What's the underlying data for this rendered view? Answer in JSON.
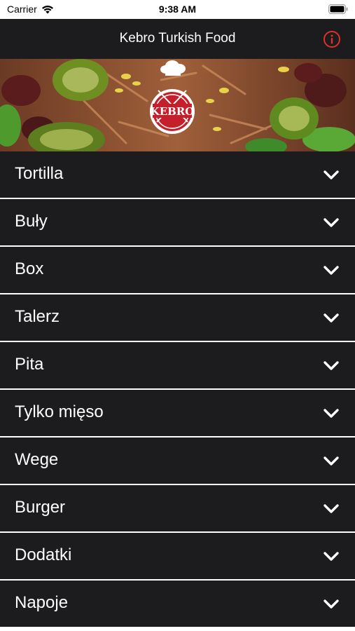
{
  "status_bar": {
    "carrier": "Carrier",
    "time": "9:38 AM"
  },
  "nav": {
    "title": "Kebro Turkish Food",
    "info_icon": "info-icon",
    "accent_color": "#e0302a"
  },
  "banner": {
    "logo_text": "KEBRO"
  },
  "menu": {
    "items": [
      {
        "label": "Tortilla"
      },
      {
        "label": "Buły"
      },
      {
        "label": "Box"
      },
      {
        "label": "Talerz"
      },
      {
        "label": "Pita"
      },
      {
        "label": "Tylko mięso"
      },
      {
        "label": "Wege"
      },
      {
        "label": "Burger"
      },
      {
        "label": "Dodatki"
      },
      {
        "label": "Napoje"
      }
    ]
  }
}
